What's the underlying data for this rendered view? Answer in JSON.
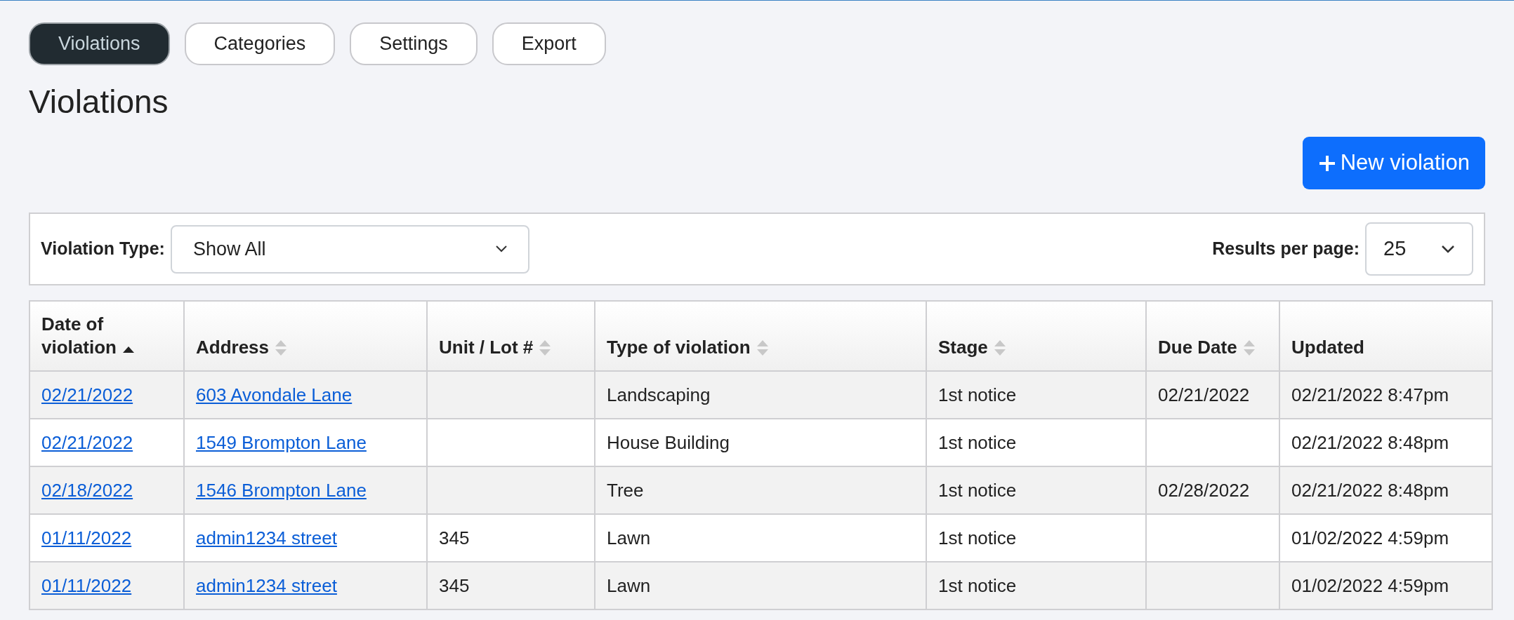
{
  "tabs": [
    {
      "label": "Violations",
      "selected": true
    },
    {
      "label": "Categories",
      "selected": false
    },
    {
      "label": "Settings",
      "selected": false
    },
    {
      "label": "Export",
      "selected": false
    }
  ],
  "heading": "Violations",
  "new_button": {
    "label": "New violation"
  },
  "filters": {
    "type_label": "Violation Type:",
    "type_value": "Show All",
    "per_page_label": "Results per page:",
    "per_page_value": "25"
  },
  "table": {
    "columns": [
      {
        "label": "Date of violation",
        "sortable": true,
        "sorted_ascending": true
      },
      {
        "label": "Address",
        "sortable": true,
        "sorted_ascending": false
      },
      {
        "label": "Unit / Lot #",
        "sortable": true,
        "sorted_ascending": false
      },
      {
        "label": "Type of violation",
        "sortable": true,
        "sorted_ascending": false
      },
      {
        "label": "Stage",
        "sortable": true,
        "sorted_ascending": false
      },
      {
        "label": "Due Date",
        "sortable": true,
        "sorted_ascending": false
      },
      {
        "label": "Updated",
        "sortable": false
      }
    ],
    "rows": [
      {
        "date": "02/21/2022",
        "address": "603 Avondale Lane",
        "unit": "",
        "type": "Landscaping",
        "stage": "1st notice",
        "due": "02/21/2022",
        "updated": "02/21/2022 8:47pm"
      },
      {
        "date": "02/21/2022",
        "address": "1549 Brompton Lane",
        "unit": "",
        "type": "House Building",
        "stage": "1st notice",
        "due": "",
        "updated": "02/21/2022 8:48pm"
      },
      {
        "date": "02/18/2022",
        "address": "1546 Brompton Lane",
        "unit": "",
        "type": "Tree",
        "stage": "1st notice",
        "due": "02/28/2022",
        "updated": "02/21/2022 8:48pm"
      },
      {
        "date": "01/11/2022",
        "address": "admin1234 street",
        "unit": "345",
        "type": "Lawn",
        "stage": "1st notice",
        "due": "",
        "updated": "01/02/2022 4:59pm"
      },
      {
        "date": "01/11/2022",
        "address": "admin1234 street",
        "unit": "345",
        "type": "Lawn",
        "stage": "1st notice",
        "due": "",
        "updated": "01/02/2022 4:59pm"
      }
    ]
  }
}
